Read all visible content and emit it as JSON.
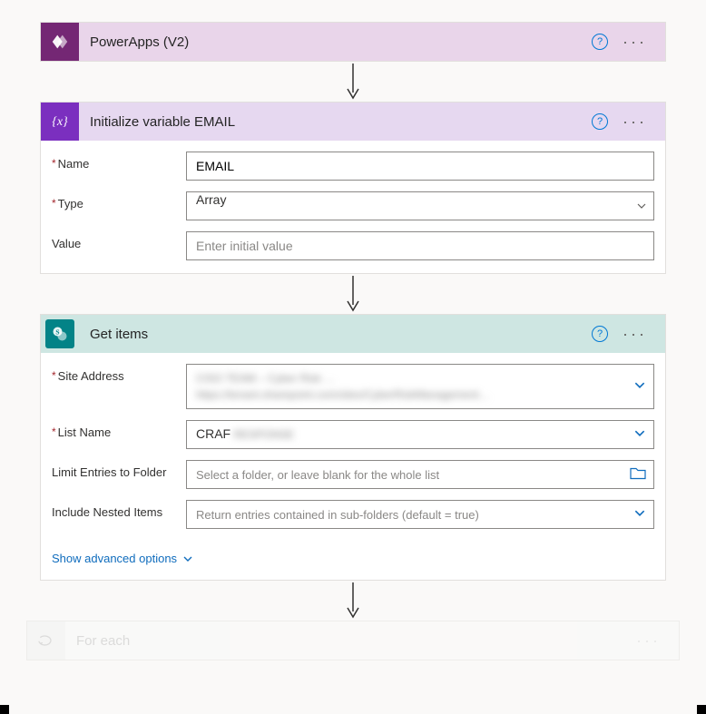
{
  "colors": {
    "powerapps": "#742774",
    "variable": "#7b2fbf",
    "sharepoint": "#038387",
    "link": "#0f6cbd"
  },
  "cards": {
    "powerapps": {
      "title": "PowerApps (V2)"
    },
    "initvar": {
      "title": "Initialize variable EMAIL",
      "fields": {
        "name_label": "Name",
        "name_value": "EMAIL",
        "type_label": "Type",
        "type_value": "Array",
        "value_label": "Value",
        "value_placeholder": "Enter initial value"
      }
    },
    "getitems": {
      "title": "Get items",
      "fields": {
        "site_label": "Site Address",
        "site_value_line1": "CISO TEAM – Cyber Risk …",
        "site_value_line2": "https://tenant.sharepoint.com/sites/CyberRiskManagement…",
        "list_label": "List Name",
        "list_value": "CRAF",
        "list_value_blur": " RESPONSE",
        "folder_label": "Limit Entries to Folder",
        "folder_placeholder": "Select a folder, or leave blank for the whole list",
        "nested_label": "Include Nested Items",
        "nested_placeholder": "Return entries contained in sub-folders (default = true)"
      },
      "advanced_link": "Show advanced options"
    },
    "foreach": {
      "title": "For each"
    }
  }
}
